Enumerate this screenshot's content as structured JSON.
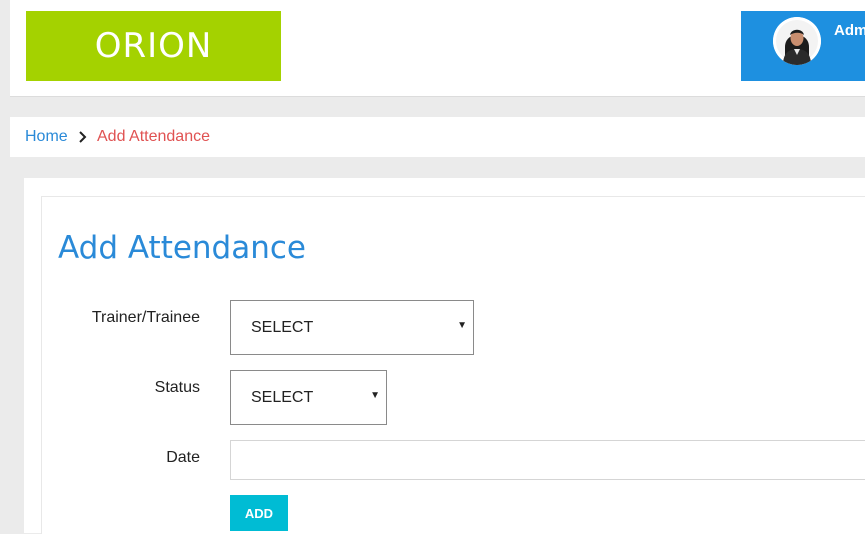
{
  "header": {
    "logo_text": "ORION",
    "user_name": "Adm",
    "colors": {
      "logo_bg": "#a4d200",
      "user_box_bg": "#1e90e0"
    }
  },
  "breadcrumb": {
    "home": "Home",
    "separator_icon": "chevron-right-icon",
    "current": "Add Attendance"
  },
  "form": {
    "title": "Add Attendance",
    "fields": [
      {
        "label": "Trainer/Trainee",
        "type": "select",
        "value": "SELECT"
      },
      {
        "label": "Status",
        "type": "select",
        "value": "SELECT"
      },
      {
        "label": "Date",
        "type": "input",
        "value": ""
      }
    ],
    "submit_label": "ADD"
  },
  "colors": {
    "accent": "#2a8ad8",
    "breadcrumb_current": "#e05252",
    "button": "#00bcd4"
  }
}
